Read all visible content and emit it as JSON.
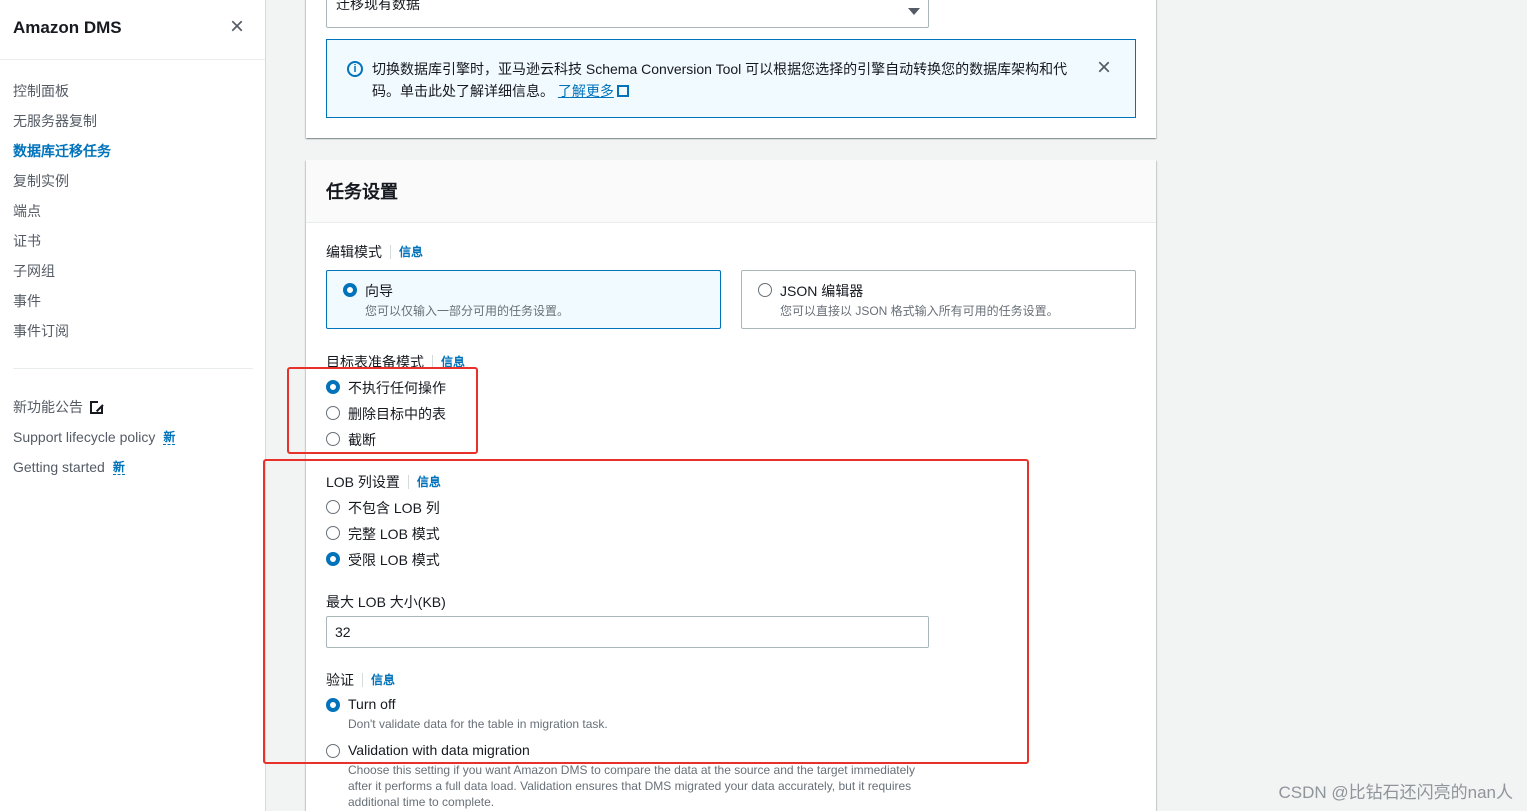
{
  "sidebar": {
    "title": "Amazon DMS",
    "close_icon": "close-icon",
    "nav": [
      {
        "label": "控制面板"
      },
      {
        "label": "无服务器复制"
      },
      {
        "label": "数据库迁移任务",
        "active": true
      },
      {
        "label": "复制实例"
      },
      {
        "label": "端点"
      },
      {
        "label": "证书"
      },
      {
        "label": "子网组"
      },
      {
        "label": "事件"
      },
      {
        "label": "事件订阅"
      }
    ],
    "secondary": [
      {
        "label": "新功能公告",
        "icon": "external-link-icon"
      },
      {
        "label": "Support lifecycle policy",
        "badge": "新"
      },
      {
        "label": "Getting started",
        "badge": "新"
      }
    ]
  },
  "top_panel": {
    "select_value": "迁移现有数据",
    "alert": {
      "text": "切换数据库引擎时，亚马逊云科技 Schema Conversion Tool 可以根据您选择的引擎自动转换您的数据库架构和代码。单击此处了解详细信息。",
      "link": "了解更多"
    }
  },
  "task_settings": {
    "title": "任务设置",
    "edit_mode": {
      "label": "编辑模式",
      "info": "信息",
      "options": [
        {
          "title": "向导",
          "desc": "您可以仅输入一部分可用的任务设置。",
          "selected": true
        },
        {
          "title": "JSON 编辑器",
          "desc": "您可以直接以 JSON 格式输入所有可用的任务设置。",
          "selected": false
        }
      ]
    },
    "target_prep": {
      "label": "目标表准备模式",
      "info": "信息",
      "options": [
        {
          "label": "不执行任何操作",
          "selected": true
        },
        {
          "label": "删除目标中的表",
          "selected": false
        },
        {
          "label": "截断",
          "selected": false
        }
      ]
    },
    "lob": {
      "label": "LOB 列设置",
      "info": "信息",
      "options": [
        {
          "label": "不包含 LOB 列",
          "selected": false
        },
        {
          "label": "完整 LOB 模式",
          "selected": false
        },
        {
          "label": "受限 LOB 模式",
          "selected": true
        }
      ],
      "max_size_label": "最大 LOB 大小(KB)",
      "max_size_value": "32"
    },
    "validation": {
      "label": "验证",
      "info": "信息",
      "options": [
        {
          "label": "Turn off",
          "desc": "Don't validate data for the table in migration task.",
          "selected": true
        },
        {
          "label": "Validation with data migration",
          "desc": "Choose this setting if you want Amazon DMS to compare the data at the source and the target immediately after it performs a full data load. Validation ensures that DMS migrated your data accurately, but it requires additional time to complete.",
          "selected": false
        }
      ]
    }
  },
  "watermark": "CSDN @比钻石还闪亮的nan人",
  "colors": {
    "accent": "#0073bb",
    "highlight": "#e8312a"
  }
}
